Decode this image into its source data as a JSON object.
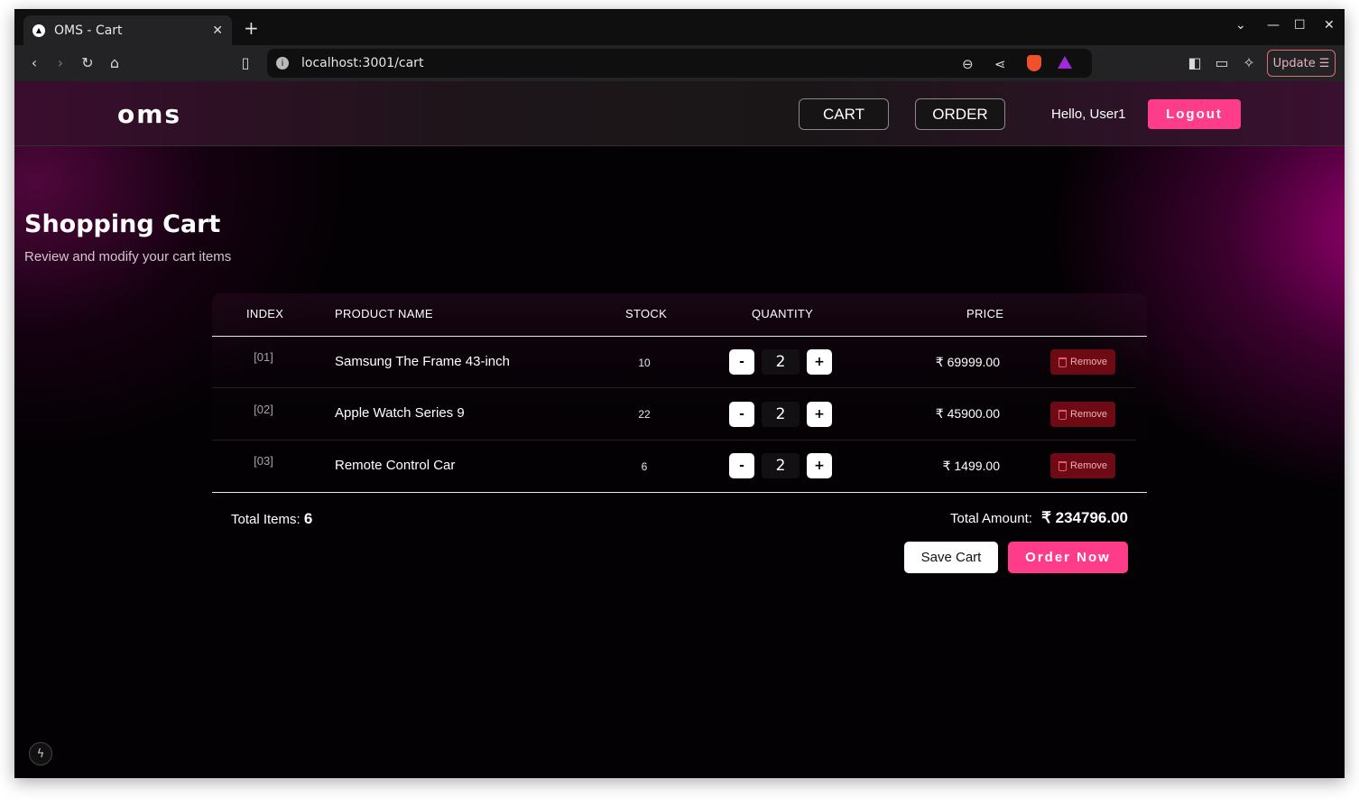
{
  "browser": {
    "tab_title": "OMS - Cart",
    "tab_close": "✕",
    "new_tab": "+",
    "url": "localhost:3001/cart",
    "update_label": "Update",
    "window_controls": {
      "chevron": "⌄",
      "minimize": "—",
      "maximize": "☐",
      "close": "✕"
    }
  },
  "navbar": {
    "logo": "oms",
    "cart_label": "CART",
    "order_label": "ORDER",
    "greeting": "Hello, User1",
    "logout_label": "Logout"
  },
  "page": {
    "title": "Shopping Cart",
    "subtitle": "Review and modify your cart items"
  },
  "table": {
    "headers": {
      "index": "INDEX",
      "product_name": "PRODUCT NAME",
      "stock": "STOCK",
      "quantity": "QUANTITY",
      "price": "PRICE"
    },
    "rows": [
      {
        "index": "[01]",
        "name": "Samsung The Frame 43-inch",
        "stock": "10",
        "quantity": "2",
        "price": "₹ 69999.00",
        "remove_label": "Remove"
      },
      {
        "index": "[02]",
        "name": "Apple Watch Series 9",
        "stock": "22",
        "quantity": "2",
        "price": "₹ 45900.00",
        "remove_label": "Remove"
      },
      {
        "index": "[03]",
        "name": "Remote Control Car",
        "stock": "6",
        "quantity": "2",
        "price": "₹ 1499.00",
        "remove_label": "Remove"
      }
    ],
    "decrement_label": "-",
    "increment_label": "+"
  },
  "summary": {
    "total_items_label": "Total Items:",
    "total_items_value": "6",
    "total_amount_label": "Total Amount:",
    "total_amount_value": "₹ 234796.00",
    "save_label": "Save Cart",
    "order_label": "Order Now"
  },
  "colors": {
    "accent": "#ff3c8a",
    "remove_bg": "#6d0a14",
    "page_bg": "#040104"
  }
}
